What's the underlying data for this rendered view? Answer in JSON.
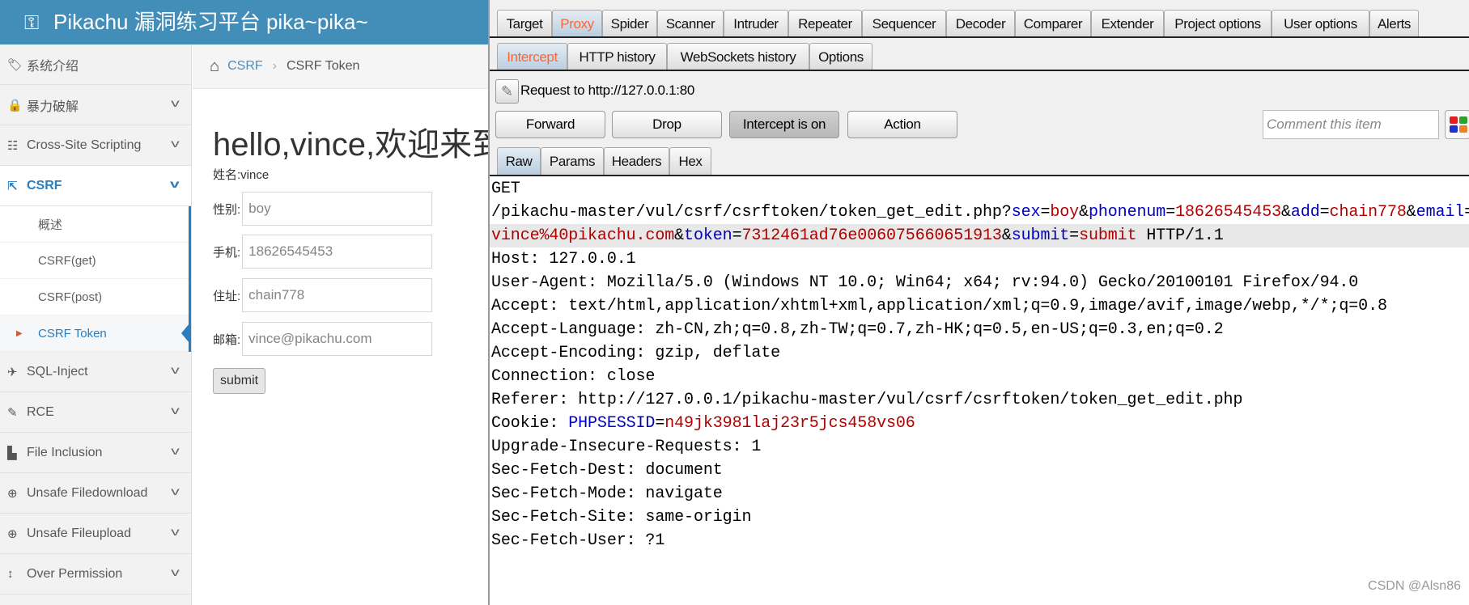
{
  "pikachu": {
    "title": "Pikachu 漏洞练习平台 pika~pika~",
    "sidebar": [
      {
        "label": "系统介绍",
        "icon": "tags-icon",
        "chev": false
      },
      {
        "label": "暴力破解",
        "icon": "lock-icon",
        "chev": true
      },
      {
        "label": "Cross-Site Scripting",
        "icon": "list-icon",
        "chev": true
      },
      {
        "label": "CSRF",
        "icon": "share-icon",
        "chev": true,
        "open": true
      },
      {
        "label": "SQL-Inject",
        "icon": "plane-icon",
        "chev": true
      },
      {
        "label": "RCE",
        "icon": "pencil-icon",
        "chev": true
      },
      {
        "label": "File Inclusion",
        "icon": "file-icon",
        "chev": true
      },
      {
        "label": "Unsafe Filedownload",
        "icon": "download-icon",
        "chev": true
      },
      {
        "label": "Unsafe Fileupload",
        "icon": "upload-icon",
        "chev": true
      },
      {
        "label": "Over Permission",
        "icon": "text-height-icon",
        "chev": true
      }
    ],
    "csrf_sub": [
      "概述",
      "CSRF(get)",
      "CSRF(post)",
      "CSRF Token"
    ],
    "csrf_active": "CSRF Token",
    "breadcrumb": {
      "link": "CSRF",
      "current": "CSRF Token"
    },
    "hello": "hello,vince,欢迎来到",
    "name_line": "姓名:vince",
    "fields": [
      {
        "label": "性别:",
        "value": "boy"
      },
      {
        "label": "手机:",
        "value": "18626545453"
      },
      {
        "label": "住址:",
        "value": "chain778"
      },
      {
        "label": "邮箱:",
        "value": "vince@pikachu.com"
      }
    ],
    "submit": "submit",
    "header_color": "#438eb9"
  },
  "burp": {
    "tabs": [
      "Target",
      "Proxy",
      "Spider",
      "Scanner",
      "Intruder",
      "Repeater",
      "Sequencer",
      "Decoder",
      "Comparer",
      "Extender",
      "Project options",
      "User options",
      "Alerts"
    ],
    "active_tab": "Proxy",
    "subtabs": [
      "Intercept",
      "HTTP history",
      "WebSockets history",
      "Options"
    ],
    "active_subtab": "Intercept",
    "request_to": "Request to http://127.0.0.1:80",
    "buttons": {
      "forward": "Forward",
      "drop": "Drop",
      "intercept": "Intercept is on",
      "action": "Action"
    },
    "comment_placeholder": "Comment this item",
    "view_tabs": [
      "Raw",
      "Params",
      "Headers",
      "Hex"
    ],
    "active_view": "Raw",
    "accent": "#ff6633",
    "request_lines": [
      [
        {
          "t": "GET"
        }
      ],
      [
        {
          "t": "/pikachu-master/vul/csrf/csrftoken/token_get_edit.php?"
        },
        {
          "t": "sex",
          "k": "param"
        },
        {
          "t": "="
        },
        {
          "t": "boy",
          "k": "value"
        },
        {
          "t": "&"
        },
        {
          "t": "phonenum",
          "k": "param"
        },
        {
          "t": "="
        },
        {
          "t": "18626545453",
          "k": "value"
        },
        {
          "t": "&"
        },
        {
          "t": "add",
          "k": "param"
        },
        {
          "t": "="
        },
        {
          "t": "chain778",
          "k": "value"
        },
        {
          "t": "&"
        },
        {
          "t": "email",
          "k": "param"
        },
        {
          "t": "="
        }
      ],
      [
        {
          "t": "vince%40pikachu.com",
          "k": "value"
        },
        {
          "t": "&"
        },
        {
          "t": "token",
          "k": "param"
        },
        {
          "t": "="
        },
        {
          "t": "7312461ad76e006075660651913",
          "k": "value"
        },
        {
          "t": "&"
        },
        {
          "t": "submit",
          "k": "param"
        },
        {
          "t": "="
        },
        {
          "t": "submit",
          "k": "value"
        },
        {
          "t": " HTTP/1.1"
        }
      ],
      [
        {
          "t": "Host: 127.0.0.1"
        }
      ],
      [
        {
          "t": "User-Agent: Mozilla/5.0 (Windows NT 10.0; Win64; x64; rv:94.0) Gecko/20100101 Firefox/94.0"
        }
      ],
      [
        {
          "t": "Accept: text/html,application/xhtml+xml,application/xml;q=0.9,image/avif,image/webp,*/*;q=0.8"
        }
      ],
      [
        {
          "t": "Accept-Language: zh-CN,zh;q=0.8,zh-TW;q=0.7,zh-HK;q=0.5,en-US;q=0.3,en;q=0.2"
        }
      ],
      [
        {
          "t": "Accept-Encoding: gzip, deflate"
        }
      ],
      [
        {
          "t": "Connection: close"
        }
      ],
      [
        {
          "t": "Referer: http://127.0.0.1/pikachu-master/vul/csrf/csrftoken/token_get_edit.php"
        }
      ],
      [
        {
          "t": "Cookie: "
        },
        {
          "t": "PHPSESSID",
          "k": "param"
        },
        {
          "t": "="
        },
        {
          "t": "n49jk3981laj23r5jcs458vs06",
          "k": "value"
        }
      ],
      [
        {
          "t": "Upgrade-Insecure-Requests: 1"
        }
      ],
      [
        {
          "t": "Sec-Fetch-Dest: document"
        }
      ],
      [
        {
          "t": "Sec-Fetch-Mode: navigate"
        }
      ],
      [
        {
          "t": "Sec-Fetch-Site: same-origin"
        }
      ],
      [
        {
          "t": "Sec-Fetch-User: ?1"
        }
      ]
    ],
    "highlight_line": 3
  },
  "watermark": "CSDN @Alsn86"
}
